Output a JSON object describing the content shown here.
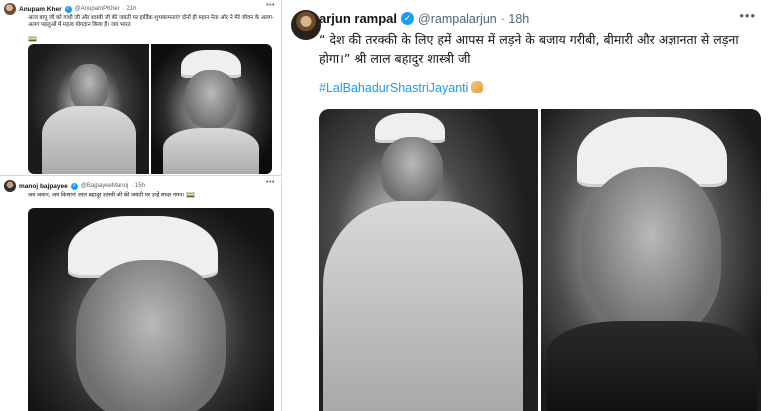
{
  "tweets": {
    "anupam": {
      "name": "Anupam Kher",
      "handle": "@AnupamPKher",
      "time": "· 21h",
      "text": "आज बापू जी को गांधी जी और शास्त्री जी की जयंती पर हार्दिक शुभकामनाएं! दोनों ही महान नेता ओर ने मेरे जीवन के अलग-अलग पहलुओं में महत्व योगदान किया है। जय भारत",
      "verified_icon": "check-icon",
      "media": [
        "gandhi-photo",
        "shastri-photo"
      ]
    },
    "manoj": {
      "name": "manoj bajpayee",
      "handle": "@BajpayeeManoj",
      "time": "· 15h",
      "text": "जय जवान, जय किसान! लाल बहादुर शास्त्री जी की जयंती पर उन्हें सादर नमन।",
      "verified_icon": "check-icon",
      "media": [
        "shastri-closeup-photo"
      ]
    },
    "arjun": {
      "name": "arjun rampal",
      "handle": "@rampalarjun",
      "time": "· 18h",
      "text": "“ देश की तरक्की के लिए हमें आपस में लड़ने के बजाय गरीबी, बीमारी और अज्ञानता से लड़ना होगा।” श्री लाल बहादुर शास्त्री जी",
      "hashtag": "#LalBahadurShastriJayanti",
      "verified_icon": "check-icon",
      "media": [
        "shastri-standing-photo",
        "shastri-portrait-photo"
      ]
    }
  },
  "icons": {
    "more": "more-icon",
    "verified": "check-icon",
    "flag": "india-flag-icon",
    "pray": "folded-hands-icon"
  },
  "colors": {
    "link": "#1d9bf0",
    "text": "#0f1419",
    "muted": "#536471",
    "border": "#cfd9de"
  }
}
